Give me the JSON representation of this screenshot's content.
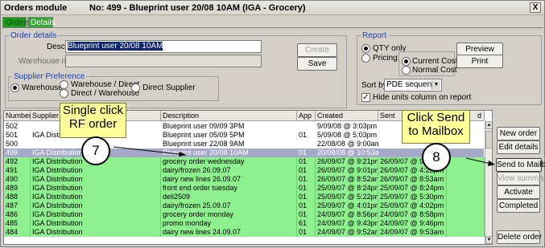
{
  "window": {
    "title_left": "Orders module",
    "title_right": "No: 499 - Blueprint user 20/08 10AM  (IGA - Grocery)",
    "close": "X"
  },
  "tabs": [
    "Orders",
    "Details"
  ],
  "order_details": {
    "legend": "Order details",
    "desc_label": "Desc",
    "desc_value": "Blueprint user 20/08 10AM",
    "warehouse_note_label": "Warehouse note"
  },
  "buttons": {
    "create": "Create",
    "save": "Save",
    "preview": "Preview",
    "print": "Print"
  },
  "supplier_pref": {
    "legend": "Supplier Preference",
    "options": [
      "Warehouse",
      "Warehouse / Direct",
      "Direct / Warehouse",
      "Direct Supplier"
    ]
  },
  "report": {
    "legend": "Report",
    "qty_only": "QTY only",
    "pricing": "Pricing:",
    "current_cost": "Current Cost",
    "normal_cost": "Normal Cost",
    "sort_by_label": "Sort by",
    "sort_by_value": "PDE sequence",
    "hide_units": "Hide units column on report"
  },
  "table": {
    "headers": [
      "Number",
      "Supplier",
      "Description",
      "App",
      "Created",
      "Sent",
      "d"
    ],
    "rows": [
      {
        "num": "502",
        "supplier": "",
        "desc": "Blueprint user 09/09 3PM",
        "app": "",
        "created": "9/09/08 @ 3:03pm",
        "sent": "",
        "style": "white"
      },
      {
        "num": "501",
        "supplier": "IGA Distribution",
        "desc": "Blueprint user 05/09 5PM",
        "app": "01",
        "created": "5/09/08 @ 5:03pm",
        "sent": "",
        "style": "white"
      },
      {
        "num": "500",
        "supplier": "",
        "desc": "Blueprint user 22/08 9AM",
        "app": "",
        "created": "22/08/08 @ 9:00am",
        "sent": "",
        "style": "white"
      },
      {
        "num": "499",
        "supplier": "IGA Distribution",
        "desc": "Blueprint user 20/08 10AM",
        "app": "01",
        "created": "20/08/08 @ 10:53am",
        "sent": "",
        "style": "sel"
      },
      {
        "num": "492",
        "supplier": "IGA Distribution",
        "desc": "grocery order wednesday",
        "app": "01",
        "created": "26/09/07 @ 9:21pm",
        "sent": "26/09/07 @ 9:21pm",
        "style": "green"
      },
      {
        "num": "491",
        "supplier": "IGA Distribution",
        "desc": "dairy/frozen 26.09.07",
        "app": "01",
        "created": "26/09/07 @ 9:01pm",
        "sent": "26/09/07 @ 4:23pm",
        "style": "green"
      },
      {
        "num": "490",
        "supplier": "IGA Distribution",
        "desc": "dairy new lines 26.09.07",
        "app": "01",
        "created": "26/09/07 @ 8:52am",
        "sent": "26/09/07 @ 8:53am",
        "style": "green"
      },
      {
        "num": "489",
        "supplier": "IGA Distribution",
        "desc": "front end order tuesday",
        "app": "01",
        "created": "25/09/07 @ 8:24pm",
        "sent": "25/09/07 @ 8:24pm",
        "style": "green"
      },
      {
        "num": "488",
        "supplier": "IGA Distribution",
        "desc": "deli2509",
        "app": "01",
        "created": "25/09/07 @ 5:22pm",
        "sent": "25/09/07 @ 5:30pm",
        "style": "green"
      },
      {
        "num": "487",
        "supplier": "IGA Distribution",
        "desc": "dairy/frozen 25.09.07",
        "app": "01",
        "created": "25/09/07 @ 4:01pm",
        "sent": "25/09/07 @ 4:02pm",
        "style": "green"
      },
      {
        "num": "486",
        "supplier": "IGA Distribution",
        "desc": "grocery order monday",
        "app": "01",
        "created": "24/09/07 @ 8:56pm",
        "sent": "24/09/07 @ 8:58pm",
        "style": "green"
      },
      {
        "num": "485",
        "supplier": "IGA Distribution",
        "desc": "promo monday",
        "app": "61",
        "created": "24/09/07 @ 9:43pm",
        "sent": "24/09/07 @ 9:46pm",
        "style": "green"
      },
      {
        "num": "484",
        "supplier": "IGA Distribution",
        "desc": "dairy new lines 24.09.07",
        "app": "01",
        "created": "24/09/07 @ 9:52am",
        "sent": "24/09/07 @ 9:53am",
        "style": "green"
      }
    ]
  },
  "side_buttons": {
    "new_order": "New order",
    "edit_details": "Edit details",
    "send_to_mailbox": "Send to Mailbox",
    "view_summary": "View summary",
    "activate": "Activate",
    "completed": "Completed",
    "delete_order": "Delete order"
  },
  "callouts": {
    "c1_line1": "Single click",
    "c1_line2": "RF order",
    "c1_step": "7",
    "c2_line1": "Click Send",
    "c2_line2": "to Mailbox",
    "c2_step": "8"
  }
}
